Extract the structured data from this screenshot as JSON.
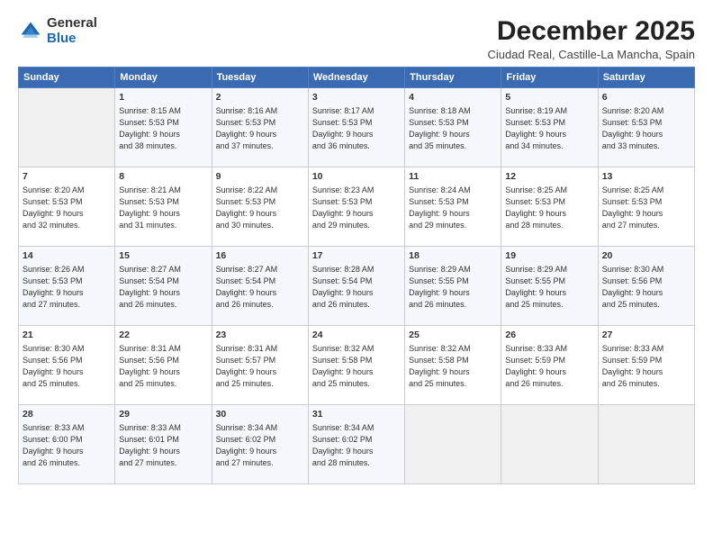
{
  "logo": {
    "general": "General",
    "blue": "Blue"
  },
  "title": "December 2025",
  "subtitle": "Ciudad Real, Castille-La Mancha, Spain",
  "headers": [
    "Sunday",
    "Monday",
    "Tuesday",
    "Wednesday",
    "Thursday",
    "Friday",
    "Saturday"
  ],
  "weeks": [
    [
      {
        "day": "",
        "info": ""
      },
      {
        "day": "1",
        "info": "Sunrise: 8:15 AM\nSunset: 5:53 PM\nDaylight: 9 hours\nand 38 minutes."
      },
      {
        "day": "2",
        "info": "Sunrise: 8:16 AM\nSunset: 5:53 PM\nDaylight: 9 hours\nand 37 minutes."
      },
      {
        "day": "3",
        "info": "Sunrise: 8:17 AM\nSunset: 5:53 PM\nDaylight: 9 hours\nand 36 minutes."
      },
      {
        "day": "4",
        "info": "Sunrise: 8:18 AM\nSunset: 5:53 PM\nDaylight: 9 hours\nand 35 minutes."
      },
      {
        "day": "5",
        "info": "Sunrise: 8:19 AM\nSunset: 5:53 PM\nDaylight: 9 hours\nand 34 minutes."
      },
      {
        "day": "6",
        "info": "Sunrise: 8:20 AM\nSunset: 5:53 PM\nDaylight: 9 hours\nand 33 minutes."
      }
    ],
    [
      {
        "day": "7",
        "info": "Sunrise: 8:20 AM\nSunset: 5:53 PM\nDaylight: 9 hours\nand 32 minutes."
      },
      {
        "day": "8",
        "info": "Sunrise: 8:21 AM\nSunset: 5:53 PM\nDaylight: 9 hours\nand 31 minutes."
      },
      {
        "day": "9",
        "info": "Sunrise: 8:22 AM\nSunset: 5:53 PM\nDaylight: 9 hours\nand 30 minutes."
      },
      {
        "day": "10",
        "info": "Sunrise: 8:23 AM\nSunset: 5:53 PM\nDaylight: 9 hours\nand 29 minutes."
      },
      {
        "day": "11",
        "info": "Sunrise: 8:24 AM\nSunset: 5:53 PM\nDaylight: 9 hours\nand 29 minutes."
      },
      {
        "day": "12",
        "info": "Sunrise: 8:25 AM\nSunset: 5:53 PM\nDaylight: 9 hours\nand 28 minutes."
      },
      {
        "day": "13",
        "info": "Sunrise: 8:25 AM\nSunset: 5:53 PM\nDaylight: 9 hours\nand 27 minutes."
      }
    ],
    [
      {
        "day": "14",
        "info": "Sunrise: 8:26 AM\nSunset: 5:53 PM\nDaylight: 9 hours\nand 27 minutes."
      },
      {
        "day": "15",
        "info": "Sunrise: 8:27 AM\nSunset: 5:54 PM\nDaylight: 9 hours\nand 26 minutes."
      },
      {
        "day": "16",
        "info": "Sunrise: 8:27 AM\nSunset: 5:54 PM\nDaylight: 9 hours\nand 26 minutes."
      },
      {
        "day": "17",
        "info": "Sunrise: 8:28 AM\nSunset: 5:54 PM\nDaylight: 9 hours\nand 26 minutes."
      },
      {
        "day": "18",
        "info": "Sunrise: 8:29 AM\nSunset: 5:55 PM\nDaylight: 9 hours\nand 26 minutes."
      },
      {
        "day": "19",
        "info": "Sunrise: 8:29 AM\nSunset: 5:55 PM\nDaylight: 9 hours\nand 25 minutes."
      },
      {
        "day": "20",
        "info": "Sunrise: 8:30 AM\nSunset: 5:56 PM\nDaylight: 9 hours\nand 25 minutes."
      }
    ],
    [
      {
        "day": "21",
        "info": "Sunrise: 8:30 AM\nSunset: 5:56 PM\nDaylight: 9 hours\nand 25 minutes."
      },
      {
        "day": "22",
        "info": "Sunrise: 8:31 AM\nSunset: 5:56 PM\nDaylight: 9 hours\nand 25 minutes."
      },
      {
        "day": "23",
        "info": "Sunrise: 8:31 AM\nSunset: 5:57 PM\nDaylight: 9 hours\nand 25 minutes."
      },
      {
        "day": "24",
        "info": "Sunrise: 8:32 AM\nSunset: 5:58 PM\nDaylight: 9 hours\nand 25 minutes."
      },
      {
        "day": "25",
        "info": "Sunrise: 8:32 AM\nSunset: 5:58 PM\nDaylight: 9 hours\nand 25 minutes."
      },
      {
        "day": "26",
        "info": "Sunrise: 8:33 AM\nSunset: 5:59 PM\nDaylight: 9 hours\nand 26 minutes."
      },
      {
        "day": "27",
        "info": "Sunrise: 8:33 AM\nSunset: 5:59 PM\nDaylight: 9 hours\nand 26 minutes."
      }
    ],
    [
      {
        "day": "28",
        "info": "Sunrise: 8:33 AM\nSunset: 6:00 PM\nDaylight: 9 hours\nand 26 minutes."
      },
      {
        "day": "29",
        "info": "Sunrise: 8:33 AM\nSunset: 6:01 PM\nDaylight: 9 hours\nand 27 minutes."
      },
      {
        "day": "30",
        "info": "Sunrise: 8:34 AM\nSunset: 6:02 PM\nDaylight: 9 hours\nand 27 minutes."
      },
      {
        "day": "31",
        "info": "Sunrise: 8:34 AM\nSunset: 6:02 PM\nDaylight: 9 hours\nand 28 minutes."
      },
      {
        "day": "",
        "info": ""
      },
      {
        "day": "",
        "info": ""
      },
      {
        "day": "",
        "info": ""
      }
    ]
  ]
}
